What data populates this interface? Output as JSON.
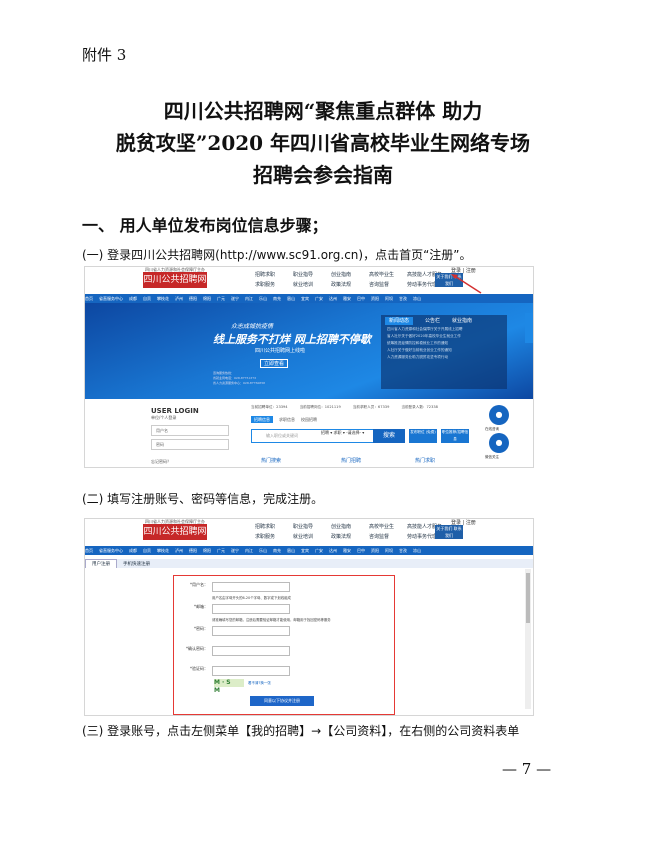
{
  "attachment_label": "附件 3",
  "title_lines": [
    "四川公共招聘网“聚焦重点群体 助力",
    "脱贫攻坚”2020 年四川省高校毕业生网络专场",
    "招聘会参会指南"
  ],
  "section_heading": "一、 用人单位发布岗位信息步骤；",
  "steps": [
    "(一) 登录四川公共招聘网(http://www.sc91.org.cn)，点击首页“注册”。",
    "(二) 填写注册账号、密码等信息，完成注册。",
    "(三) 登录账号，点击左侧菜单【我的招聘】→【公司资料】，在右侧的公司资料表单"
  ],
  "page_number": "— 7 —",
  "screenshot1": {
    "logo_top": "四川省人力资源和社会保障厅主办",
    "logo": "四川公共招聘网",
    "logo_sub": "SICHUAN PUBLIC WEB",
    "nav": [
      "招聘求职",
      "职业指导",
      "创业指南",
      "高校毕业生",
      "高技能人才服务",
      "求职服务",
      "就业培训",
      "政策法规",
      "咨询监督",
      "劳动事务代理"
    ],
    "about_btn": "关于我们 联系我们",
    "register_link": "登录 | 注册",
    "cities": [
      "首页",
      "省直服务中心",
      "成都",
      "自贡",
      "攀枝花",
      "泸州",
      "德阳",
      "绵阳",
      "广元",
      "遂宁",
      "内江",
      "乐山",
      "南充",
      "眉山",
      "宜宾",
      "广安",
      "达州",
      "雅安",
      "巴中",
      "资阳",
      "阿坝",
      "甘孜",
      "凉山"
    ],
    "slogan_small": "众志成城抗疫情",
    "slogan_main": "线上服务不打烊 网上招聘不停歇",
    "slogan_sub": "四川公共招聘网上线啦",
    "slogan_btn": "立即查看",
    "contact_lines": [
      "咨询服务热线：",
      "省就业局电话：028-87751373",
      "省人力资源服务中心：028-87750858"
    ],
    "news_tabs": [
      "新闻动态",
      "公告栏",
      "就业指南"
    ],
    "news_items": [
      "四川省人力资源和社会保障厅关于开展线上招聘",
      "省人社厅关于做好2020年高校毕业生就业工作",
      "统筹推进疫情防控和稳就业工作的通知",
      "人社厅关于做好当前就业创业工作的通知",
      "人力资源服务业助力脱贫攻坚专项行动"
    ],
    "login_title": "USER LOGIN",
    "login_sub": "单位/个人登录",
    "login_user": "用户名",
    "login_pass": "密码",
    "login_forgot": "忘记密码？",
    "stats": [
      "当前招聘单位：23394",
      "当前招聘岗位：1021119",
      "当前求职人员：67339",
      "当前登录人数：72338"
    ],
    "search_tabs": [
      "招聘信息",
      "求职信息",
      "校园招聘"
    ],
    "search_placeholder": "输入职位或关键词",
    "search_select": "招聘 ▾  求职 ▾  -请选择- ▾",
    "search_btn": "搜索",
    "extra_btn1": "发布职位 (免费)",
    "extra_btn2": "职位推荐/招聘信息",
    "hot_labels": [
      "热门搜索",
      "热门招聘",
      "热门求职"
    ],
    "side_labels": [
      "在线咨询",
      "微信关注"
    ]
  },
  "screenshot2": {
    "tabs": [
      "用户注册",
      "手机快速注册"
    ],
    "fields": [
      {
        "label": "*用户名：",
        "hint": "用户名由字母开头的6-20个字母、数字或下划线组成"
      },
      {
        "label": "*邮箱：",
        "hint": "请准确填写您的邮箱，注册后需要验证邮箱才能使用，邮箱用于找回密码等服务"
      },
      {
        "label": "*密码：",
        "hint": ""
      },
      {
        "label": "*确认密码：",
        "hint": ""
      },
      {
        "label": "*验证码：",
        "hint": ""
      }
    ],
    "captcha": "M·S M",
    "captcha_link": "看不清?换一张",
    "submit": "同意以下协议并注册"
  }
}
